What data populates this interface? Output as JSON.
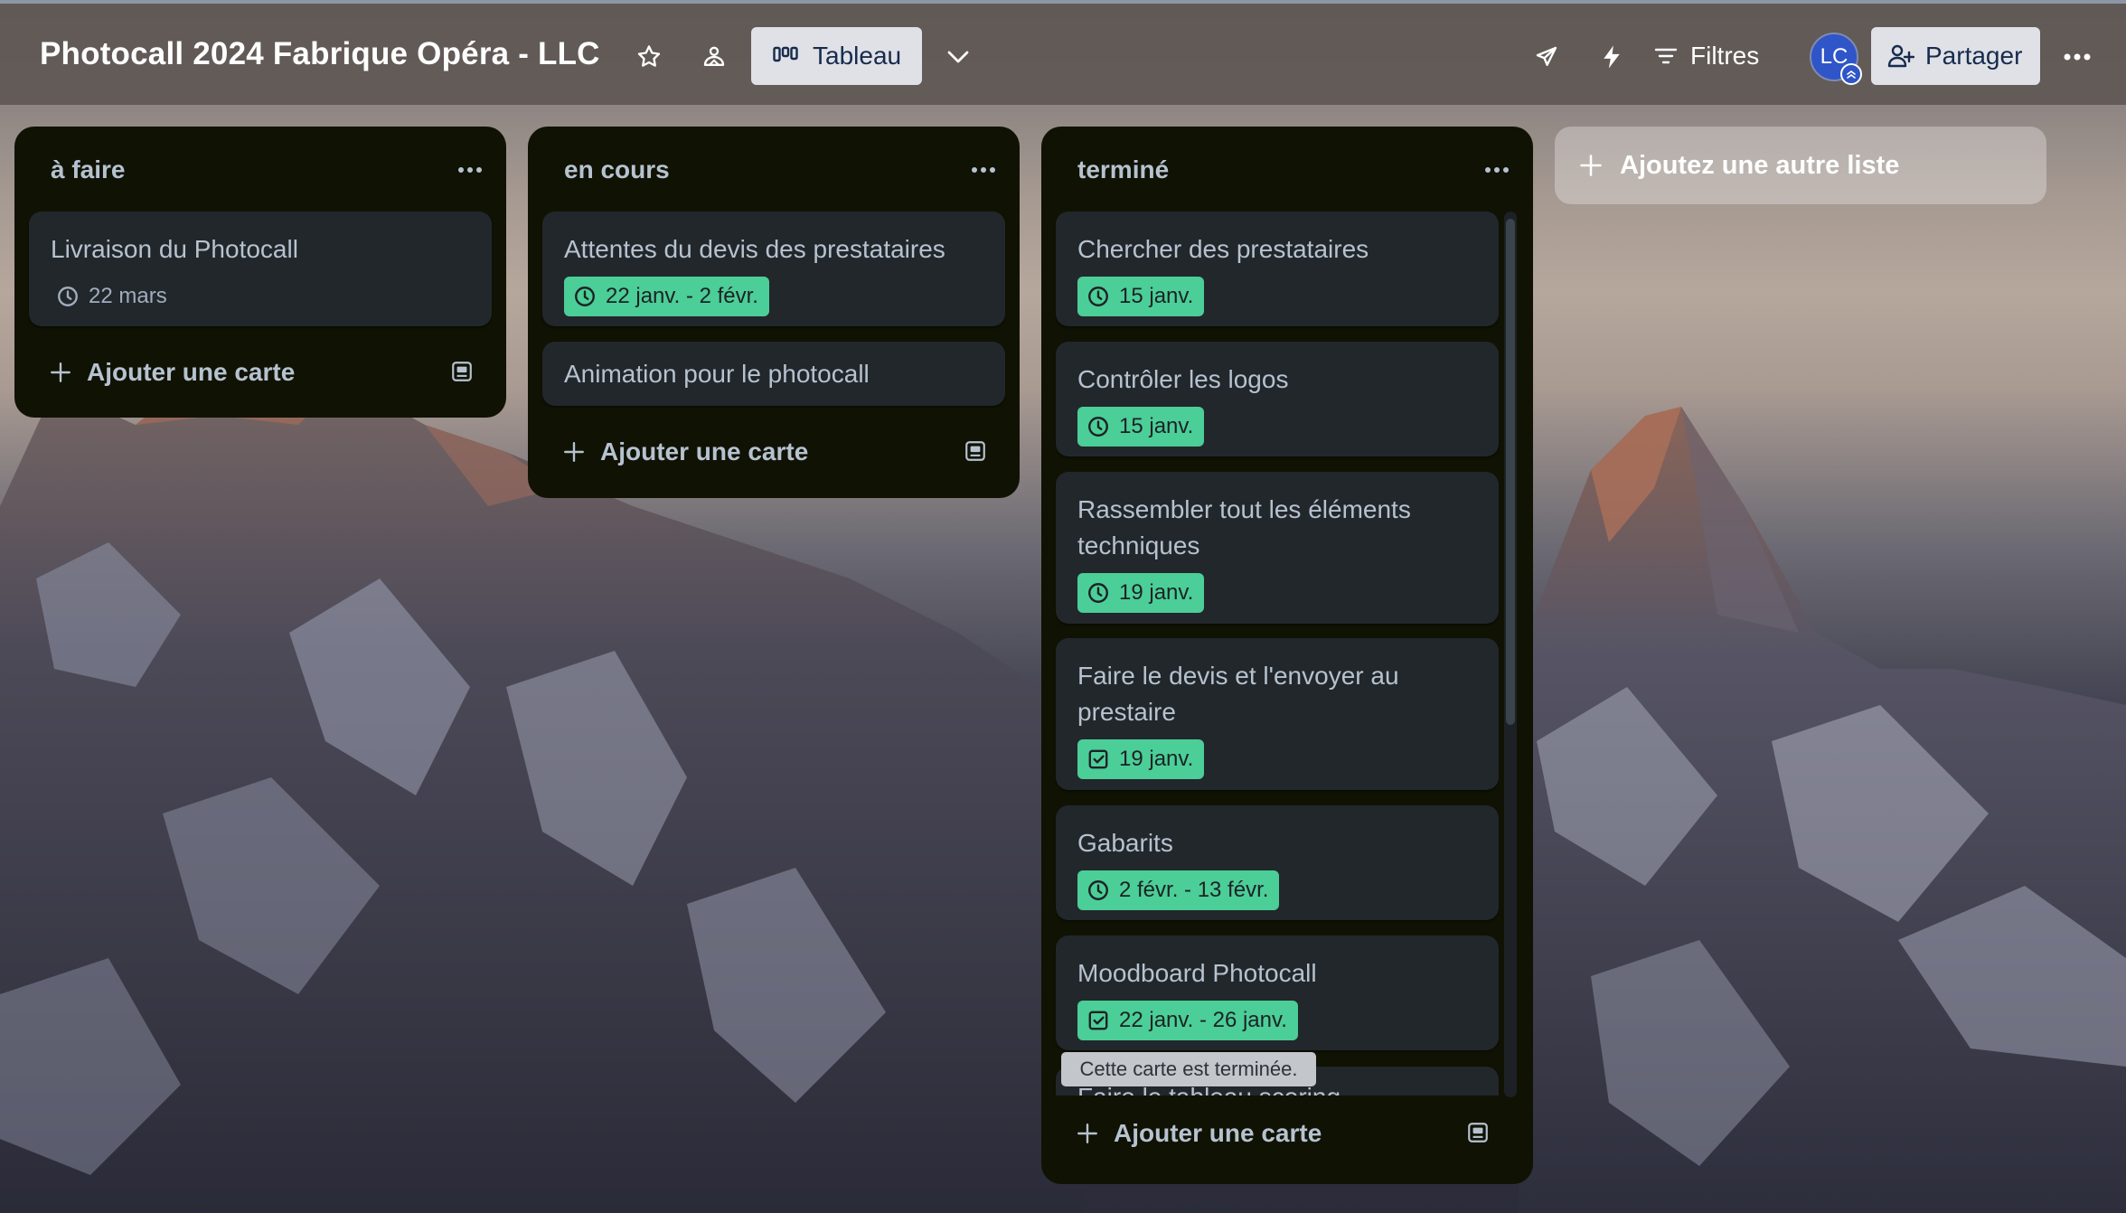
{
  "board": {
    "title": "Photocall 2024 Fabrique Opéra - LLC",
    "view_label": "Tableau",
    "filters_label": "Filtres",
    "avatar_initials": "LC",
    "share_label": "Partager"
  },
  "lists": [
    {
      "title": "à faire",
      "cards": [
        {
          "title": "Livraison du Photocall",
          "date": "22 mars",
          "status": "pending",
          "icon": "clock-icon"
        }
      ],
      "add_label": "Ajouter une carte"
    },
    {
      "title": "en cours",
      "cards": [
        {
          "title": "Attentes du devis des prestataires",
          "date": "22 janv. - 2 févr.",
          "status": "complete",
          "icon": "clock-icon"
        },
        {
          "title": "Animation pour le photocall"
        }
      ],
      "add_label": "Ajouter une carte"
    },
    {
      "title": "terminé",
      "cards": [
        {
          "title": "Chercher des prestataires",
          "date": "15 janv.",
          "status": "complete",
          "icon": "clock-icon"
        },
        {
          "title": "Contrôler les logos",
          "date": "15 janv.",
          "status": "complete",
          "icon": "clock-icon"
        },
        {
          "title": "Rassembler tout les éléments techniques",
          "date": "19 janv.",
          "status": "complete",
          "icon": "clock-icon"
        },
        {
          "title": "Faire le devis et l'envoyer au prestaire",
          "date": "19 janv.",
          "status": "complete",
          "icon": "checkbox-icon"
        },
        {
          "title": "Gabarits",
          "date": "2 févr. - 13 févr.",
          "status": "complete",
          "icon": "clock-icon"
        },
        {
          "title": "Moodboard Photocall",
          "date": "22 janv. - 26 janv.",
          "status": "complete",
          "icon": "checkbox-icon"
        },
        {
          "title": "Faire le tableau scoring"
        }
      ],
      "add_label": "Ajouter une carte"
    }
  ],
  "tooltip": "Cette carte est terminée.",
  "add_list_label": "Ajoutez une autre liste",
  "colors": {
    "due_complete": "#4bce97",
    "list_bg": "#101204",
    "card_bg": "#22272b",
    "avatar": "#2f55c8"
  }
}
